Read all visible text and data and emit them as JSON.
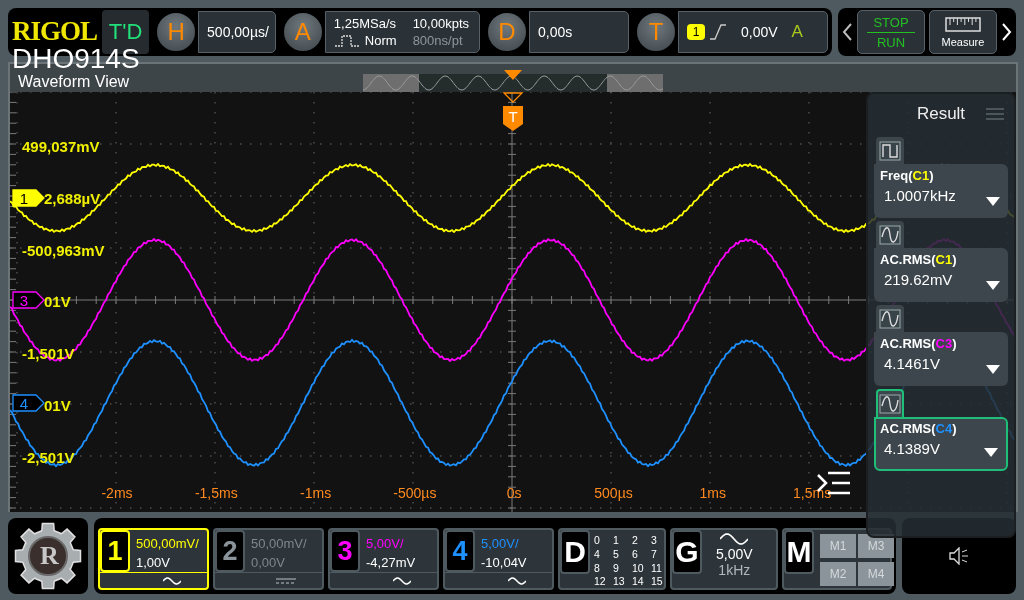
{
  "brand": {
    "logo": "RIGOL",
    "model": "DHO914S"
  },
  "top_bar": {
    "mode": "T'D",
    "horizontal": {
      "key": "H",
      "scale": "500,00µs/"
    },
    "acquire": {
      "key": "A",
      "sample_rate": "1,25MSa/s",
      "mode": "Norm",
      "memory_depth": "10,00kpts",
      "time_per_point": "800ns/pt"
    },
    "delay": {
      "key": "D",
      "value": "0,00s"
    },
    "trigger": {
      "key": "T",
      "source": "1",
      "level": "0,00V",
      "sweep": "A"
    },
    "stop_label": "STOP",
    "run_label": "RUN",
    "measure_label": "Measure"
  },
  "waveform_view": {
    "title": "Waveform View",
    "vertical_labels": [
      "499,037mV",
      "2,688µV",
      "-500,963mV",
      "01V",
      "-1,501V",
      "01V",
      "-2,501V"
    ],
    "time_labels": [
      "-2ms",
      "-1,5ms",
      "-1ms",
      "-500µs",
      "0s",
      "500µs",
      "1ms",
      "1,5ms"
    ],
    "trigger_marker": "T",
    "channel_markers": [
      {
        "label": "1",
        "color": "#ffff00",
        "selected": true
      },
      {
        "label": "3",
        "color": "#ff00ff",
        "selected": false
      },
      {
        "label": "4",
        "color": "#1e90ff",
        "selected": false
      }
    ]
  },
  "result_panel": {
    "title": "Result",
    "measurements": [
      {
        "kind": "frequency",
        "label_before": "Freq(",
        "source": "C1",
        "label_after": ")",
        "color": "#ffff00",
        "value": "1.0007kHz",
        "selected": false
      },
      {
        "kind": "rms",
        "label_before": "AC.RMS(",
        "source": "C1",
        "label_after": ")",
        "color": "#ffff00",
        "value": "219.62mV",
        "selected": false
      },
      {
        "kind": "rms",
        "label_before": "AC.RMS(",
        "source": "C3",
        "label_after": ")",
        "color": "#ff00ff",
        "value": "4.1461V",
        "selected": false
      },
      {
        "kind": "rms",
        "label_before": "AC.RMS(",
        "source": "C4",
        "label_after": ")",
        "color": "#1e90ff",
        "value": "4.1389V",
        "selected": true
      }
    ]
  },
  "home": {
    "letter": "R"
  },
  "channels": [
    {
      "number": "1",
      "scale": "500,00mV/",
      "offset": "1,00V",
      "kind": "ac",
      "color": "#ffff00",
      "enabled": true,
      "selected": true
    },
    {
      "number": "2",
      "scale": "50,00mV/",
      "offset": "0,00V",
      "kind": "dc",
      "color": "#8a949a",
      "enabled": false,
      "selected": false
    },
    {
      "number": "3",
      "scale": "5,00V/",
      "offset": "-4,27mV",
      "kind": "ac",
      "color": "#ff00ff",
      "enabled": true,
      "selected": false
    },
    {
      "number": "4",
      "scale": "5,00V/",
      "offset": "-10,04V",
      "kind": "ac",
      "color": "#1e90ff",
      "enabled": true,
      "selected": false
    }
  ],
  "digital": {
    "key": "D",
    "bits": [
      "0",
      "1",
      "2",
      "3",
      "4",
      "5",
      "6",
      "7",
      "8",
      "9",
      "10",
      "11",
      "12",
      "13",
      "14",
      "15"
    ]
  },
  "generator": {
    "key": "G",
    "amplitude": "5,00V",
    "frequency": "1kHz"
  },
  "math": {
    "key": "M",
    "slots": [
      "M1",
      "M3",
      "M2",
      "M4"
    ]
  }
}
